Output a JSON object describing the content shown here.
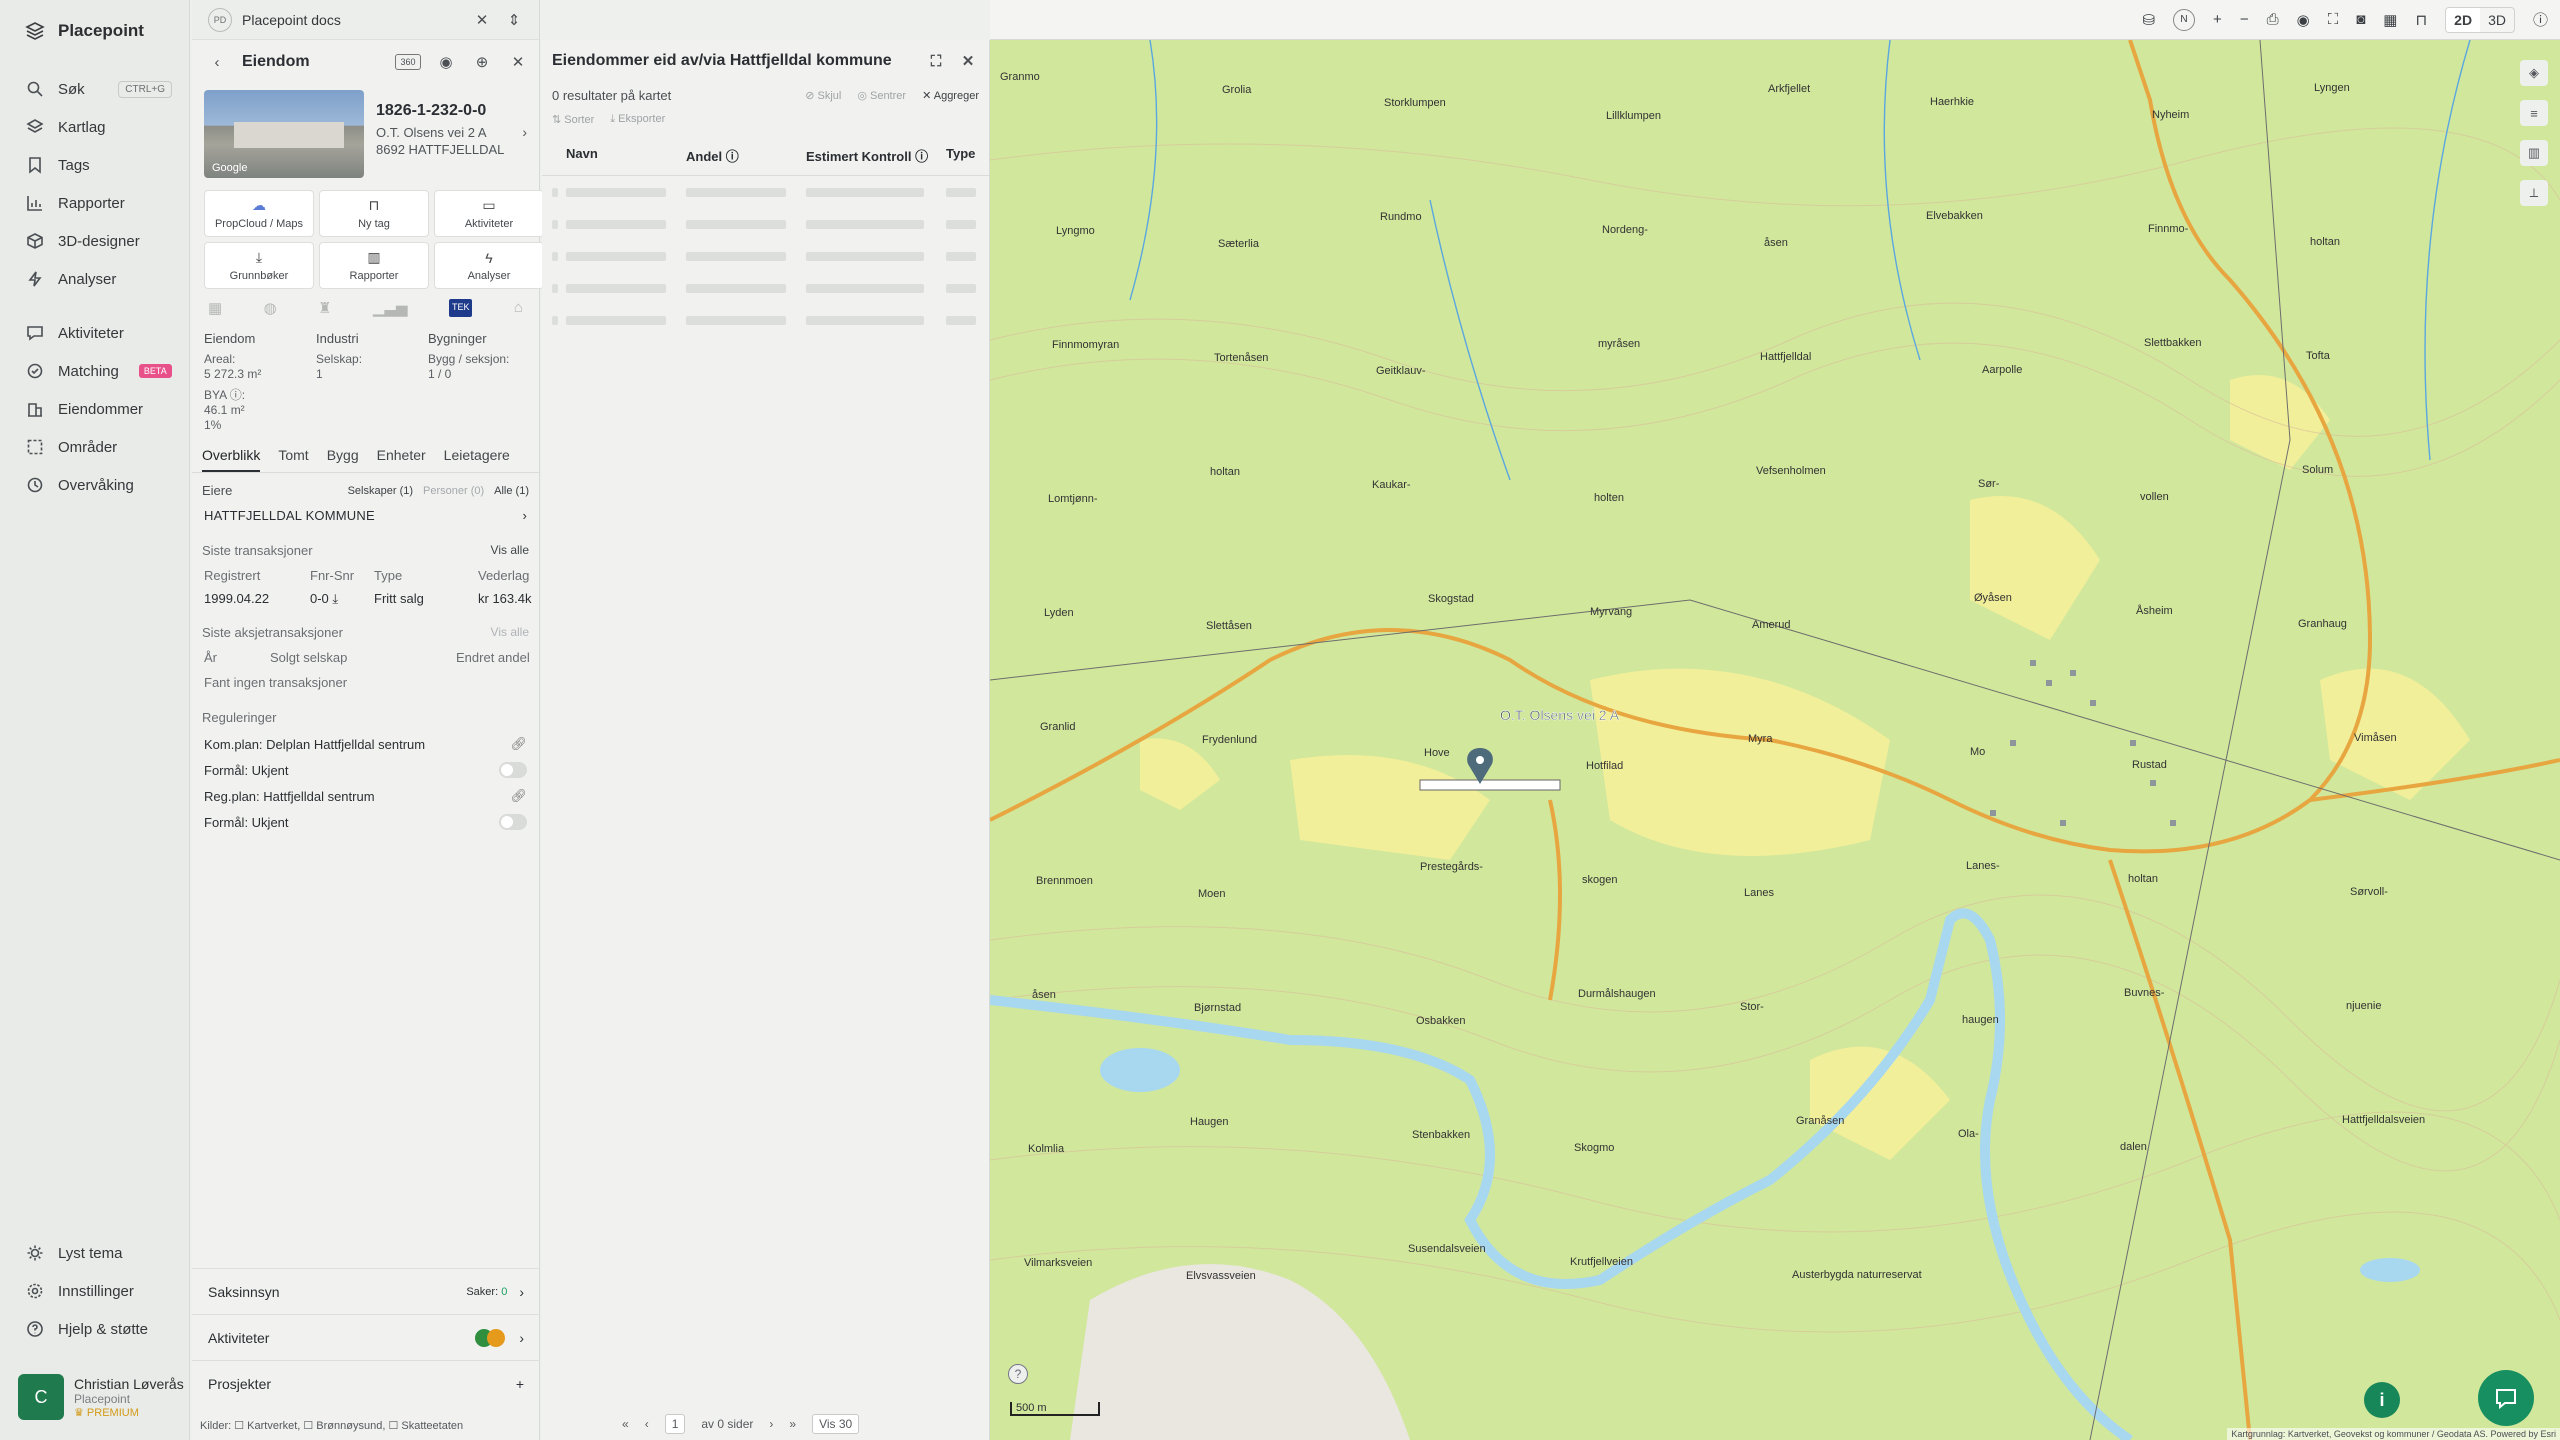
{
  "app": {
    "name": "Placepoint"
  },
  "nav": {
    "items": [
      {
        "label": "Søk",
        "shortcut": "CTRL+G"
      },
      {
        "label": "Kartlag"
      },
      {
        "label": "Tags"
      },
      {
        "label": "Rapporter"
      },
      {
        "label": "3D-designer"
      },
      {
        "label": "Analyser"
      },
      {
        "label": "Aktiviteter"
      },
      {
        "label": "Matching",
        "badge": "BETA"
      },
      {
        "label": "Eiendommer"
      },
      {
        "label": "Områder"
      },
      {
        "label": "Overvåking"
      }
    ],
    "bottom": [
      {
        "label": "Lyst tema"
      },
      {
        "label": "Innstillinger"
      },
      {
        "label": "Hjelp & støtte"
      }
    ],
    "user": {
      "initial": "C",
      "name": "Christian Løverås",
      "org": "Placepoint",
      "tier": "PREMIUM"
    }
  },
  "docbar": {
    "badge": "PD",
    "name": "Placepoint docs"
  },
  "property": {
    "header": "Eiendom",
    "id": "1826-1-232-0-0",
    "address_line1": "O.T. Olsens vei 2 A",
    "address_line2": "8692 HATTFJELLDAL",
    "photo_credit": "Google",
    "actions": [
      {
        "label": "PropCloud / Maps",
        "icon": "cloud-icon"
      },
      {
        "label": "Ny tag",
        "icon": "bookmark-icon"
      },
      {
        "label": "Aktiviteter",
        "icon": "chat-icon"
      },
      {
        "label": "Grunnbøker",
        "icon": "download-icon"
      },
      {
        "label": "Rapporter",
        "icon": "chart-icon"
      },
      {
        "label": "Analyser",
        "icon": "bolt-icon"
      }
    ],
    "tek_label": "TEK",
    "facts": {
      "eiendom": "Eiendom",
      "industri": "Industri",
      "bygninger": "Bygninger",
      "areal_label": "Areal:",
      "areal_value": "5 272.3 m²",
      "selskap_label": "Selskap:",
      "selskap_value": "1",
      "bygg_label": "Bygg / seksjon:",
      "bygg_value": "1 / 0",
      "bya_label": "BYA ⓘ:",
      "bya_value": "46.1 m²",
      "bya_pct": "1%"
    },
    "tabs": [
      "Overblikk",
      "Tomt",
      "Bygg",
      "Enheter",
      "Leietagere"
    ],
    "owners": {
      "label": "Eiere",
      "companies": "Selskaper (1)",
      "persons": "Personer (0)",
      "all": "Alle (1)",
      "owner": "HATTFJELLDAL KOMMUNE"
    },
    "transactions": {
      "title": "Siste transaksjoner",
      "see_all": "Vis alle",
      "headers": [
        "Registrert",
        "Fnr-Snr",
        "Type",
        "Vederlag"
      ],
      "rows": [
        [
          "1999.04.22",
          "0-0 ⤓",
          "Fritt salg",
          "kr 163.4k"
        ]
      ]
    },
    "share_transactions": {
      "title": "Siste aksjetransaksjoner",
      "see_all": "Vis alle",
      "headers": [
        "År",
        "Solgt selskap",
        "Endret andel"
      ],
      "empty": "Fant ingen transaksjoner"
    },
    "regulations": {
      "title": "Reguleringer",
      "rows": [
        {
          "label": "Kom.plan: Delplan Hattfjelldal sentrum",
          "kind": "link"
        },
        {
          "label": "Formål: Ukjent",
          "kind": "toggle"
        },
        {
          "label": "Reg.plan: Hattfjelldal sentrum",
          "kind": "link"
        },
        {
          "label": "Formål: Ukjent",
          "kind": "toggle"
        }
      ]
    },
    "accordions": {
      "saksinnsyn": "Saksinnsyn",
      "saker": "Saker:",
      "saker_count": "0",
      "aktiviteter": "Aktiviteter",
      "prosjekter": "Prosjekter"
    },
    "sources": "Kilder: ☐ Kartverket, ☐ Brønnøysund, ☐ Skatteetaten"
  },
  "results": {
    "title": "Eiendommer eid av/via Hattfjelldal kommune",
    "count": "0 resultater på kartet",
    "hide": "Skjul",
    "center": "Sentrer",
    "aggregate": "Aggreger",
    "sort": "Sorter",
    "export": "Eksporter",
    "columns": [
      "Navn",
      "Andel ⓘ",
      "Estimert Kontroll ⓘ",
      "Type"
    ],
    "pager": {
      "page": "1",
      "of": "av 0 sider",
      "show": "Vis 30"
    }
  },
  "topbar": {
    "mode_2d": "2D",
    "mode_3d": "3D",
    "north": "N"
  },
  "map": {
    "marker_label": "O.T. Olsens vei 2 A",
    "scale": "500 m",
    "attribution": "Kartgrunnlag: Kartverket, Geovekst og kommuner / Geodata AS. Powered by Esri",
    "places": [
      "Granmo",
      "Grolia",
      "Storklumpen",
      "Lillklumpen",
      "Arkfjellet",
      "Haerhkie",
      "Nyheim",
      "Lyngen",
      "Lyngmo",
      "Sæterlia",
      "Rundmo",
      "Nordeng-",
      "åsen",
      "Elvebakken",
      "Finnmo-",
      "holtan",
      "Finnmomyran",
      "Tortenåsen",
      "Geitklauv-",
      "myråsen",
      "Hattfjelldal",
      "Aarpolle",
      "Slettbakken",
      "Tofta",
      "Lomtjønn-",
      "holtan",
      "Kaukar-",
      "holten",
      "Vefsenholmen",
      "Sør-",
      "vollen",
      "Solum",
      "Lyden",
      "Slettåsen",
      "Skogstad",
      "Myrvang",
      "Amerud",
      "Øyåsen",
      "Åsheim",
      "Granhaug",
      "Granlid",
      "Frydenlund",
      "Hove",
      "Hotfilad",
      "Myra",
      "Mo",
      "Rustad",
      "Vimåsen",
      "Brennmoen",
      "Moen",
      "Prestegårds-",
      "skogen",
      "Lanes",
      "Lanes-",
      "holtan",
      "Sørvoll-",
      "åsen",
      "Bjørnstad",
      "Osbakken",
      "Durmålshaugen",
      "Stor-",
      "haugen",
      "Buvnes-",
      "njuenie",
      "Kolmlia",
      "Haugen",
      "Stenbakken",
      "Skogmo",
      "Granåsen",
      "Ola-",
      "dalen",
      "Hattfjelldalsveien",
      "Vilmarksveien",
      "Elvsvassveien",
      "Susendalsveien",
      "Krutfjellveien",
      "Austerbygda naturreservat"
    ]
  },
  "colors": {
    "brand_green": "#188f60",
    "avatar_green": "#1f7a4d",
    "beta_pink": "#e8508a",
    "tek_blue": "#1e3a8a",
    "road": "#e7a640",
    "water": "#a8d7f0"
  }
}
